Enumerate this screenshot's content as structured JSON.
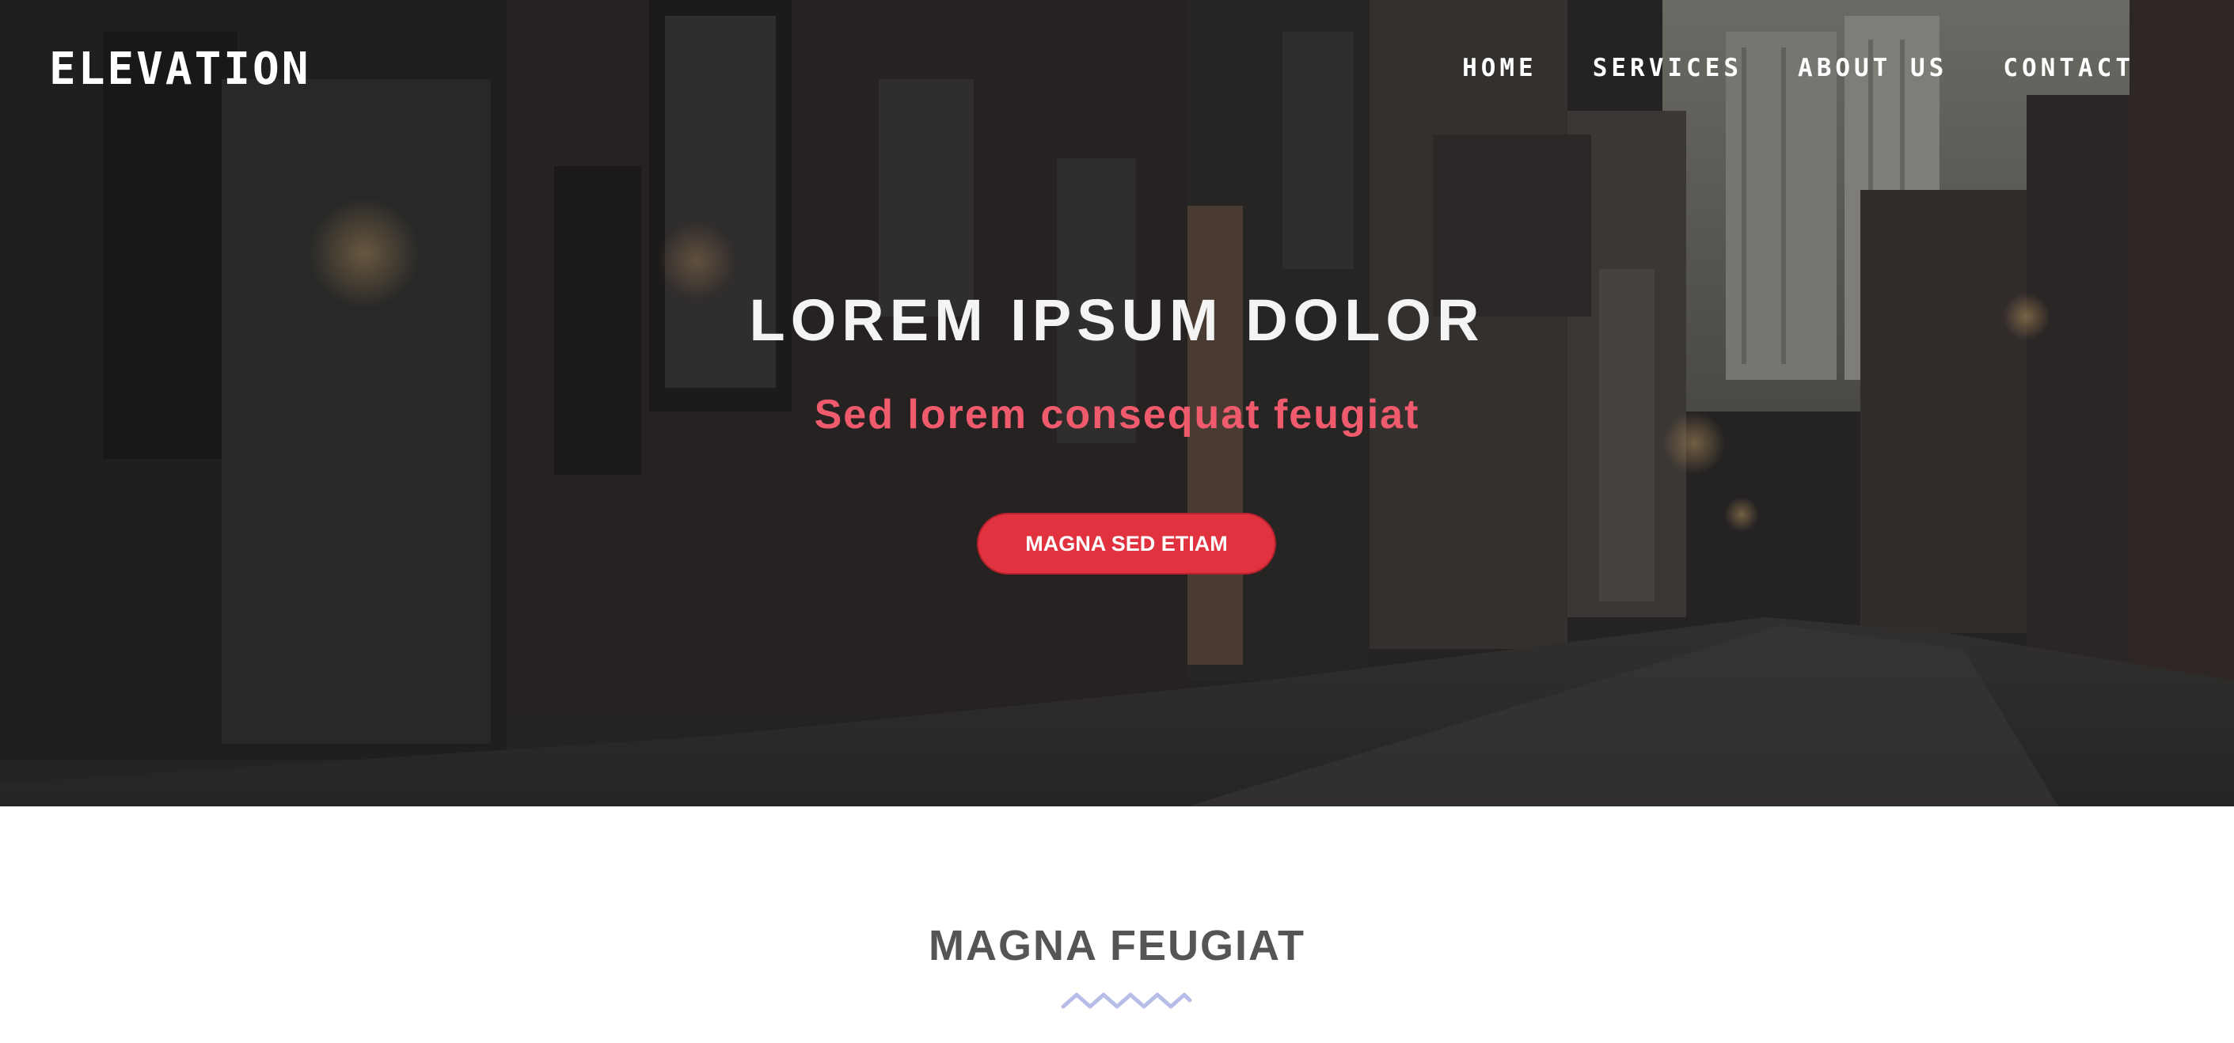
{
  "header": {
    "brand": "ELEVATION",
    "nav": [
      {
        "label": "HOME"
      },
      {
        "label": "SERVICES"
      },
      {
        "label": "ABOUT US"
      },
      {
        "label": "CONTACT"
      }
    ]
  },
  "hero": {
    "title": "LOREM IPSUM DOLOR",
    "subtitle": "Sed lorem consequat feugiat",
    "cta_label": "MAGNA SED ETIAM"
  },
  "section": {
    "title": "MAGNA FEUGIAT"
  },
  "colors": {
    "accent": "#e0323f",
    "subtitle": "#ef5b6d",
    "divider": "#b7bde6",
    "heading": "#555555"
  }
}
